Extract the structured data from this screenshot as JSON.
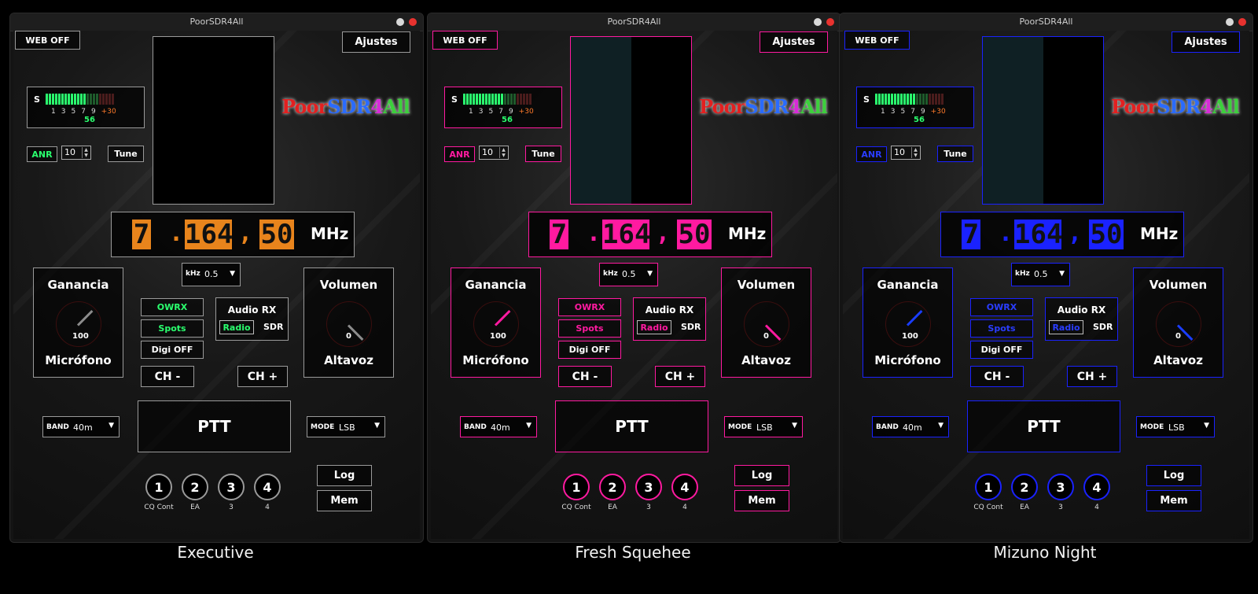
{
  "windows": [
    {
      "title": "PoorSDR4All",
      "theme_name": "Executive",
      "accent": "#9a9a9a",
      "tag_color": "#2aff6e",
      "digit_color": "#e8841c",
      "waterfall_color": "#000000",
      "needle_color": "#8c8c8c"
    },
    {
      "title": "PoorSDR4All",
      "theme_name": "Fresh Squehee",
      "accent": "#ff1aa0",
      "tag_color": "#ff1aa0",
      "digit_color": "#ff1aa0",
      "waterfall_color": "#0f2024",
      "needle_color": "#ff1aa0"
    },
    {
      "title": "PoorSDR4All",
      "theme_name": "Mizuno Night",
      "accent": "#1a22ff",
      "tag_color": "#2a3dff",
      "digit_color": "#1a22ff",
      "waterfall_color": "#0f2024",
      "needle_color": "#1a3dff"
    }
  ],
  "controls": {
    "web_off": "WEB OFF",
    "settings": "Ajustes",
    "s_label": "S",
    "s_ticks": [
      "1",
      "3",
      "5",
      "7",
      "9",
      "+30"
    ],
    "s_value": "56",
    "anr": "ANR",
    "anr_value": "10",
    "tune": "Tune",
    "logo_poor": "Poor",
    "logo_sdr": "SDR",
    "logo_4": "4",
    "logo_all": "All",
    "freq_digits": [
      "7",
      "164",
      "50"
    ],
    "freq_dot": ".",
    "freq_comma": ",",
    "mhz": "MHz",
    "step_label": "kHz",
    "step_value": "0.5",
    "gain_title": "Ganancia",
    "gain_value": "100",
    "gain_bottom": "Micrófono",
    "gain_level": 1.0,
    "owrx": "OWRX",
    "spots": "Spots",
    "digi": "Digi OFF",
    "audio_rx": "Audio RX",
    "radio": "Radio",
    "sdr": "SDR",
    "volume_title": "Volumen",
    "volume_value": "0",
    "volume_bottom": "Altavoz",
    "volume_level": 0.0,
    "ch_minus": "CH -",
    "ch_plus": "CH +",
    "band_label": "BAND",
    "band_value": "40m",
    "ptt": "PTT",
    "mode_label": "MODE",
    "mode_value": "LSB",
    "log": "Log",
    "mem": "Mem",
    "memories": [
      {
        "num": "1",
        "label": "CQ Cont"
      },
      {
        "num": "2",
        "label": "EA"
      },
      {
        "num": "3",
        "label": "3"
      },
      {
        "num": "4",
        "label": "4"
      }
    ]
  }
}
